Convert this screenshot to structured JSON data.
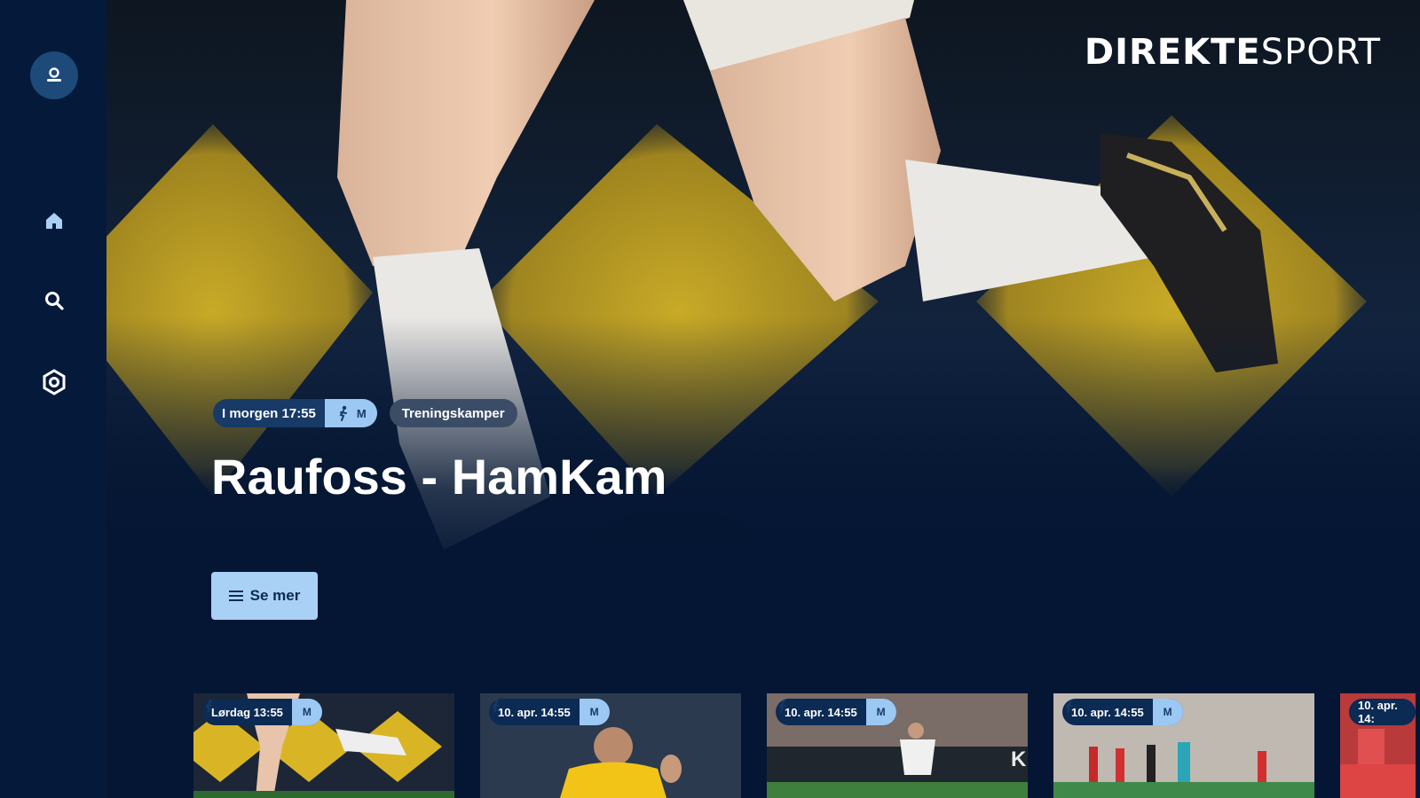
{
  "app": {
    "logo_bold": "DIREKTE",
    "logo_light": "SPORT"
  },
  "sidebar": {
    "items": [
      {
        "icon": "user-icon"
      },
      {
        "icon": "home-icon"
      },
      {
        "icon": "search-icon"
      },
      {
        "icon": "settings-icon"
      }
    ]
  },
  "hero": {
    "time": "I morgen 17:55",
    "sport_code": "M",
    "category": "Treningskamper",
    "title": "Raufoss - HamKam",
    "cta_label": "Se mer"
  },
  "cards": [
    {
      "time": "Lørdag 13:55",
      "sport_code": "M"
    },
    {
      "time": "10. apr. 14:55",
      "sport_code": "M"
    },
    {
      "time": "10. apr. 14:55",
      "sport_code": "M"
    },
    {
      "time": "10. apr. 14:55",
      "sport_code": "M"
    },
    {
      "time": "10. apr. 14:"
    }
  ],
  "colors": {
    "background": "#041633",
    "sidebar": "#051a3a",
    "accent": "#a9d1f5",
    "badge": "#173a66"
  }
}
